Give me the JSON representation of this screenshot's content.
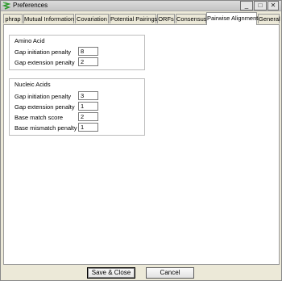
{
  "window": {
    "title": "Preferences",
    "controls": {
      "minimize": "_",
      "maximize": "□",
      "close": "✕"
    }
  },
  "tabs": [
    {
      "label": "phrap"
    },
    {
      "label": "Mutual Information"
    },
    {
      "label": "Covariation"
    },
    {
      "label": "Potential Pairings"
    },
    {
      "label": "ORFs"
    },
    {
      "label": "Consensus"
    },
    {
      "label": "Pairwise Alignment",
      "active": true
    },
    {
      "label": "General"
    }
  ],
  "amino_acid": {
    "title": "Amino Acid",
    "fields": [
      {
        "label": "Gap initiation penalty",
        "value": "8"
      },
      {
        "label": "Gap extension penalty",
        "value": "2"
      }
    ]
  },
  "nucleic_acids": {
    "title": "Nucleic Acids",
    "fields": [
      {
        "label": "Gap initiation penalty",
        "value": "3"
      },
      {
        "label": "Gap extension penalty",
        "value": "1"
      },
      {
        "label": "Base match score",
        "value": "2"
      },
      {
        "label": "Base mismatch penalty",
        "value": "1"
      }
    ]
  },
  "buttons": {
    "save_close": "Save & Close",
    "cancel": "Cancel"
  },
  "colors": {
    "chrome": "#ece9d8",
    "panel": "#ffffff",
    "icon_green": "#2e9a2e"
  },
  "icons": {
    "app": "dna-helix-icon"
  }
}
